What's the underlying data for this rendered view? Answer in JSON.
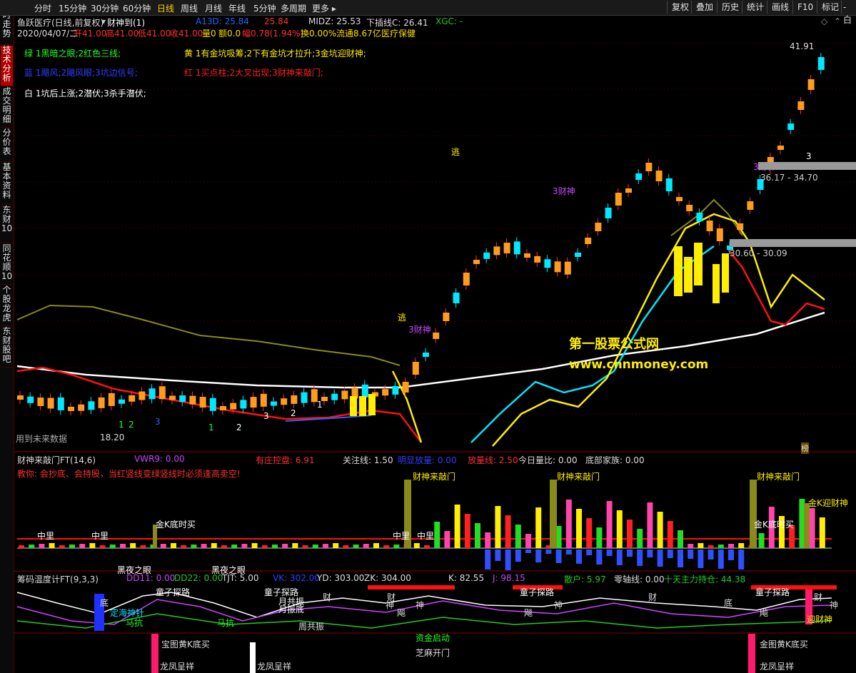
{
  "topbar": {
    "periods": [
      "分时",
      "15分钟",
      "30分钟",
      "60分钟",
      "日线",
      "周线",
      "月线",
      "年线",
      "5分钟",
      "多周期",
      "更多 ▸"
    ],
    "active_period": "日线",
    "right_buttons": [
      "复权",
      "叠加",
      "历史",
      "统计",
      "画线",
      "F10",
      "标记",
      "-白"
    ]
  },
  "sidebar": {
    "tabs": [
      "分时走势",
      "技术分析",
      "成交明细",
      "分价表",
      "基本资料",
      "东财10",
      "同花顺10",
      "个股龙虎",
      "东财股吧"
    ],
    "active": "技术分析"
  },
  "header": {
    "stock": "鱼跃医疗(日线,前复权)",
    "indicator": "财神到(1)",
    "a13d_label": "A13D: 25.84",
    "a13d_value": "25.84",
    "midz": "MIDZ: 25.53",
    "xiachaxian": "下插线C: 26.41",
    "xgc": "XGC: -",
    "date": "2020/04/07/二",
    "open": "开41.00",
    "high": "高41.00",
    "low": "低41.00",
    "close": "收41.00",
    "volume": "量0",
    "amount": "额0.0",
    "change": "幅0.78(1.94%)",
    "turnover": "换0.00%",
    "float": "流通8.67亿",
    "sector": "医疗保健"
  },
  "legend": {
    "green": "绿 1黑暗之眼;2红色三线;",
    "yellow": "黄 1有金坑吸筹;2下有金坑才拉升;3金坑迎财神;",
    "blue": "蓝 1飓风;2飓风眼;3坑边信号;",
    "red": "红 1买点柱;2大叉出现;3财神来敲门;",
    "white": "白 1坑后上涨;2潜伏;3杀手潜伏;"
  },
  "main_chart": {
    "labels": [
      "逃",
      "逃",
      "3财神",
      "3财神",
      "3财神"
    ],
    "price_high": "41.91",
    "price_low": "18.20",
    "range1": "36.17 - 34.70",
    "range2": "30.60 - 30.09",
    "watermark1": "第一股票公式网",
    "watermark2": "www.cnnmoney.com",
    "future_data": "用到未来数据",
    "bottom_counts": [
      "1",
      "2",
      "3",
      "1",
      "2",
      "3",
      "2",
      "1",
      "3"
    ],
    "corner": "榜"
  },
  "panel2": {
    "title": "财神来敲门FT(14,6)",
    "vwr": "VWR9: 0.00",
    "youzhuang": "有庄控盘: 6.91",
    "guanzhu": "关注线: 1.50",
    "mingxian": "明显放量: 0.00",
    "fangliang": "放量线: 2.50",
    "jinri": "今日量比: 0.00",
    "dibu": "底部家族: 0.00",
    "advice": "教你: 会抄底、会持股，当红竖线变绿竖线时必须逢高卖空!",
    "markers": [
      "财神来敲门",
      "财神来敲门",
      "财神来敲门",
      "金K底时买",
      "金K底时买",
      "金K迎财神",
      "中里",
      "中里",
      "中里",
      "中里",
      "黑夜之眼",
      "黑夜之眼"
    ]
  },
  "panel3": {
    "title": "筹码温度计FT(9,3,3)",
    "dd11": "DD11: 0.00",
    "dd22": "DD22: 0.00",
    "tjt": "TJT: 5.00",
    "vk": "VK: 302.00",
    "yd": "YD: 303.00",
    "zk": "ZK: 304.00",
    "k": "K: 82.55",
    "j": "J: 98.15",
    "sanhu": "散户: 5.97",
    "linzhou": "零轴线: 0.00",
    "shitian": "十天主力持仓: 44.38",
    "marks": [
      "童子探路",
      "童子探路",
      "童子探路",
      "童子探路",
      "底",
      "底",
      "定海神针",
      "马抗",
      "马抗",
      "月共振",
      "月振底",
      "周共振",
      "财",
      "财",
      "财",
      "财",
      "神",
      "神",
      "神",
      "神",
      "飚",
      "飚",
      "飚",
      "迎财神",
      "资金启动",
      "芝麻开门",
      "宝图黄K底买",
      "金图黄K底买",
      "龙凤呈祥",
      "龙凤呈祥",
      "龙凤呈祥"
    ]
  },
  "colors": {
    "up": "#ff3030",
    "down": "#00e8ff",
    "orange": "#ff9c1e",
    "green": "#22cc22",
    "yellow": "#ffee00",
    "olive": "#8a8a1a",
    "white": "#ffffff",
    "red": "#ff1010",
    "blue": "#3050ff"
  }
}
